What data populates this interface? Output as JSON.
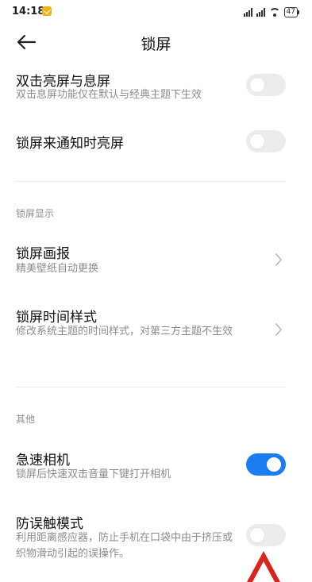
{
  "status_bar": {
    "time": "14:18",
    "battery": "47"
  },
  "header": {
    "title": "锁屏"
  },
  "settings": {
    "double_tap": {
      "title": "双击亮屏与息屏",
      "subtitle": "双击息屏功能仅在默认与经典主题下生效",
      "enabled": false
    },
    "notify_wake": {
      "title": "锁屏来通知时亮屏",
      "enabled": false
    },
    "section_display": "锁屏显示",
    "wallpaper": {
      "title": "锁屏画报",
      "subtitle": "精美壁纸自动更换"
    },
    "clock_style": {
      "title": "锁屏时间样式",
      "subtitle": "修改系统主题的时间样式，对第三方主题不生效"
    },
    "section_other": "其他",
    "quick_camera": {
      "title": "急速相机",
      "subtitle": "锁屏后快速双击音量下键打开相机",
      "enabled": true
    },
    "pocket_mode": {
      "title": "防误触模式",
      "subtitle": "利用距离感应器，防止手机在口袋中由于挤压或织物滑动引起的误操作。",
      "enabled": false
    }
  },
  "colors": {
    "accent": "#1a7df2",
    "toggle_off": "#ececec",
    "annotation": "#d9241c"
  }
}
